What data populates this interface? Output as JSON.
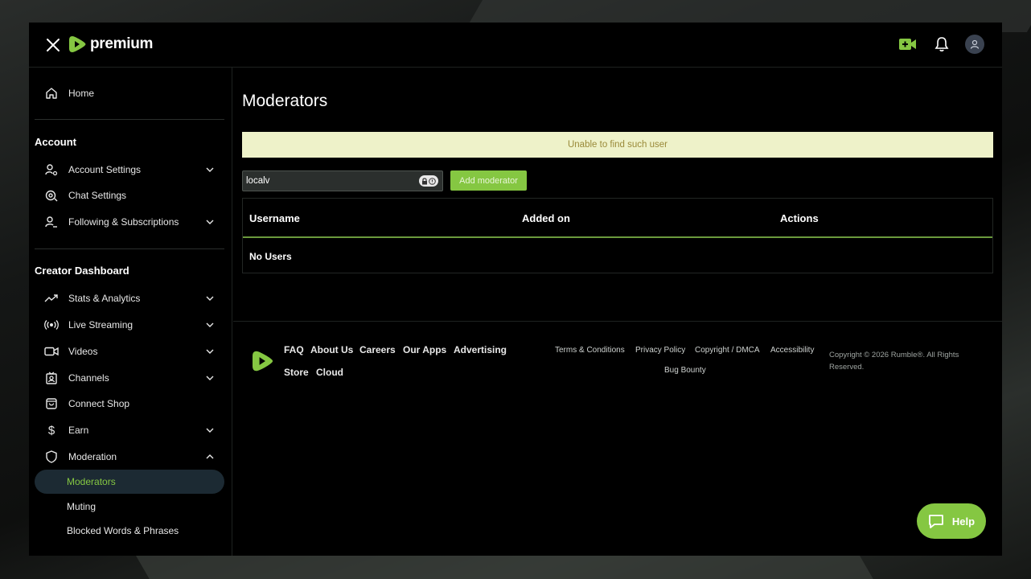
{
  "brand": {
    "name": "premium",
    "accent": "#85c742"
  },
  "topbar": {
    "icons": [
      "close-icon",
      "camera-plus-icon",
      "bell-icon",
      "user-icon"
    ]
  },
  "sidebar": {
    "home": "Home",
    "account_title": "Account",
    "account_items": [
      "Account Settings",
      "Chat Settings",
      "Following & Subscriptions"
    ],
    "creator_title": "Creator Dashboard",
    "creator_items": [
      "Stats & Analytics",
      "Live Streaming",
      "Videos",
      "Channels",
      "Connect Shop",
      "Earn",
      "Moderation"
    ],
    "moderation_sub": [
      "Moderators",
      "Muting",
      "Blocked Words & Phrases"
    ]
  },
  "main": {
    "title": "Moderators",
    "alert": "Unable to find such user",
    "search_value": "localv",
    "add_button": "Add moderator",
    "columns": [
      "Username",
      "Added on",
      "Actions"
    ],
    "empty_text": "No Users"
  },
  "footer": {
    "links": [
      "FAQ",
      "About Us",
      "Careers",
      "Our Apps",
      "Advertising",
      "Store",
      "Cloud"
    ],
    "legal": [
      "Terms & Conditions",
      "Privacy Policy",
      "Copyright / DMCA",
      "Accessibility",
      "Bug Bounty"
    ],
    "copyright": "Copyright © 2026 Rumble®. All Rights Reserved."
  },
  "help": {
    "label": "Help"
  }
}
